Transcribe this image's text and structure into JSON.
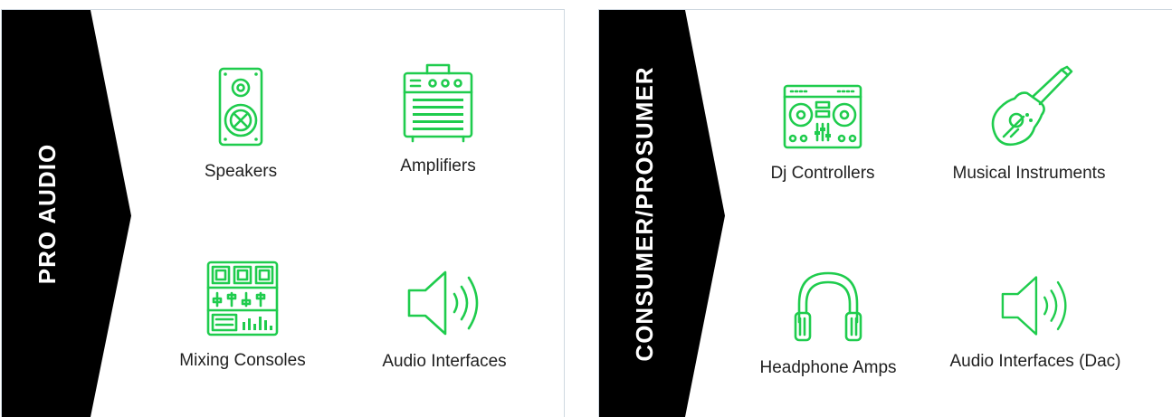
{
  "colors": {
    "accent": "#1fcc4d",
    "banner": "#000000",
    "border": "#cfd8e0"
  },
  "pro_audio": {
    "title": "PRO AUDIO",
    "items": [
      {
        "label": "Speakers",
        "icon": "speaker-icon"
      },
      {
        "label": "Amplifiers",
        "icon": "amplifier-icon"
      },
      {
        "label": "Mixing Consoles",
        "icon": "mixing-console-icon"
      },
      {
        "label": "Audio Interfaces",
        "icon": "volume-icon"
      }
    ]
  },
  "consumer": {
    "title": "CONSUMER/PROSUMER",
    "items": [
      {
        "label": "Dj Controllers",
        "icon": "dj-controller-icon"
      },
      {
        "label": "Musical Instruments",
        "icon": "guitar-icon"
      },
      {
        "label": "Headphone Amps",
        "icon": "headphones-icon"
      },
      {
        "label": "Audio Interfaces (Dac)",
        "icon": "volume-icon"
      }
    ]
  }
}
